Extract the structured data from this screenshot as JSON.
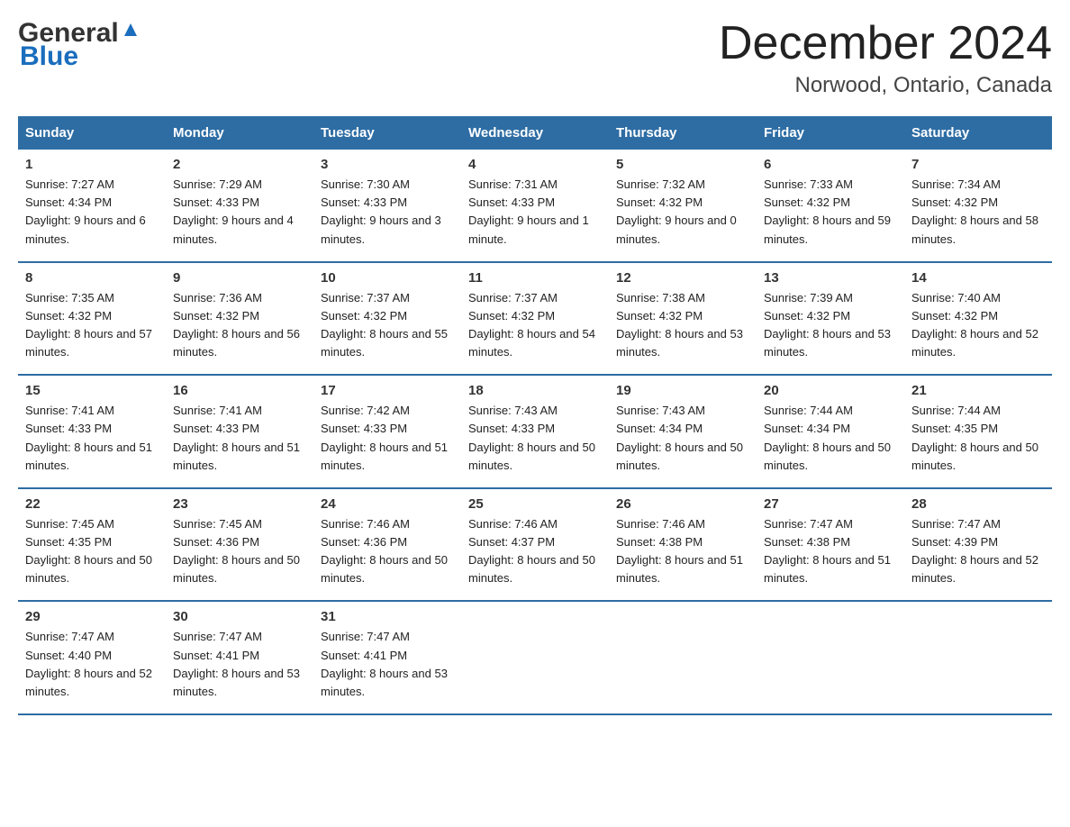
{
  "logo": {
    "general": "General",
    "blue": "Blue"
  },
  "title": "December 2024",
  "subtitle": "Norwood, Ontario, Canada",
  "headers": [
    "Sunday",
    "Monday",
    "Tuesday",
    "Wednesday",
    "Thursday",
    "Friday",
    "Saturday"
  ],
  "weeks": [
    [
      {
        "day": "1",
        "sunrise": "7:27 AM",
        "sunset": "4:34 PM",
        "daylight": "9 hours and 6 minutes."
      },
      {
        "day": "2",
        "sunrise": "7:29 AM",
        "sunset": "4:33 PM",
        "daylight": "9 hours and 4 minutes."
      },
      {
        "day": "3",
        "sunrise": "7:30 AM",
        "sunset": "4:33 PM",
        "daylight": "9 hours and 3 minutes."
      },
      {
        "day": "4",
        "sunrise": "7:31 AM",
        "sunset": "4:33 PM",
        "daylight": "9 hours and 1 minute."
      },
      {
        "day": "5",
        "sunrise": "7:32 AM",
        "sunset": "4:32 PM",
        "daylight": "9 hours and 0 minutes."
      },
      {
        "day": "6",
        "sunrise": "7:33 AM",
        "sunset": "4:32 PM",
        "daylight": "8 hours and 59 minutes."
      },
      {
        "day": "7",
        "sunrise": "7:34 AM",
        "sunset": "4:32 PM",
        "daylight": "8 hours and 58 minutes."
      }
    ],
    [
      {
        "day": "8",
        "sunrise": "7:35 AM",
        "sunset": "4:32 PM",
        "daylight": "8 hours and 57 minutes."
      },
      {
        "day": "9",
        "sunrise": "7:36 AM",
        "sunset": "4:32 PM",
        "daylight": "8 hours and 56 minutes."
      },
      {
        "day": "10",
        "sunrise": "7:37 AM",
        "sunset": "4:32 PM",
        "daylight": "8 hours and 55 minutes."
      },
      {
        "day": "11",
        "sunrise": "7:37 AM",
        "sunset": "4:32 PM",
        "daylight": "8 hours and 54 minutes."
      },
      {
        "day": "12",
        "sunrise": "7:38 AM",
        "sunset": "4:32 PM",
        "daylight": "8 hours and 53 minutes."
      },
      {
        "day": "13",
        "sunrise": "7:39 AM",
        "sunset": "4:32 PM",
        "daylight": "8 hours and 53 minutes."
      },
      {
        "day": "14",
        "sunrise": "7:40 AM",
        "sunset": "4:32 PM",
        "daylight": "8 hours and 52 minutes."
      }
    ],
    [
      {
        "day": "15",
        "sunrise": "7:41 AM",
        "sunset": "4:33 PM",
        "daylight": "8 hours and 51 minutes."
      },
      {
        "day": "16",
        "sunrise": "7:41 AM",
        "sunset": "4:33 PM",
        "daylight": "8 hours and 51 minutes."
      },
      {
        "day": "17",
        "sunrise": "7:42 AM",
        "sunset": "4:33 PM",
        "daylight": "8 hours and 51 minutes."
      },
      {
        "day": "18",
        "sunrise": "7:43 AM",
        "sunset": "4:33 PM",
        "daylight": "8 hours and 50 minutes."
      },
      {
        "day": "19",
        "sunrise": "7:43 AM",
        "sunset": "4:34 PM",
        "daylight": "8 hours and 50 minutes."
      },
      {
        "day": "20",
        "sunrise": "7:44 AM",
        "sunset": "4:34 PM",
        "daylight": "8 hours and 50 minutes."
      },
      {
        "day": "21",
        "sunrise": "7:44 AM",
        "sunset": "4:35 PM",
        "daylight": "8 hours and 50 minutes."
      }
    ],
    [
      {
        "day": "22",
        "sunrise": "7:45 AM",
        "sunset": "4:35 PM",
        "daylight": "8 hours and 50 minutes."
      },
      {
        "day": "23",
        "sunrise": "7:45 AM",
        "sunset": "4:36 PM",
        "daylight": "8 hours and 50 minutes."
      },
      {
        "day": "24",
        "sunrise": "7:46 AM",
        "sunset": "4:36 PM",
        "daylight": "8 hours and 50 minutes."
      },
      {
        "day": "25",
        "sunrise": "7:46 AM",
        "sunset": "4:37 PM",
        "daylight": "8 hours and 50 minutes."
      },
      {
        "day": "26",
        "sunrise": "7:46 AM",
        "sunset": "4:38 PM",
        "daylight": "8 hours and 51 minutes."
      },
      {
        "day": "27",
        "sunrise": "7:47 AM",
        "sunset": "4:38 PM",
        "daylight": "8 hours and 51 minutes."
      },
      {
        "day": "28",
        "sunrise": "7:47 AM",
        "sunset": "4:39 PM",
        "daylight": "8 hours and 52 minutes."
      }
    ],
    [
      {
        "day": "29",
        "sunrise": "7:47 AM",
        "sunset": "4:40 PM",
        "daylight": "8 hours and 52 minutes."
      },
      {
        "day": "30",
        "sunrise": "7:47 AM",
        "sunset": "4:41 PM",
        "daylight": "8 hours and 53 minutes."
      },
      {
        "day": "31",
        "sunrise": "7:47 AM",
        "sunset": "4:41 PM",
        "daylight": "8 hours and 53 minutes."
      },
      null,
      null,
      null,
      null
    ]
  ]
}
